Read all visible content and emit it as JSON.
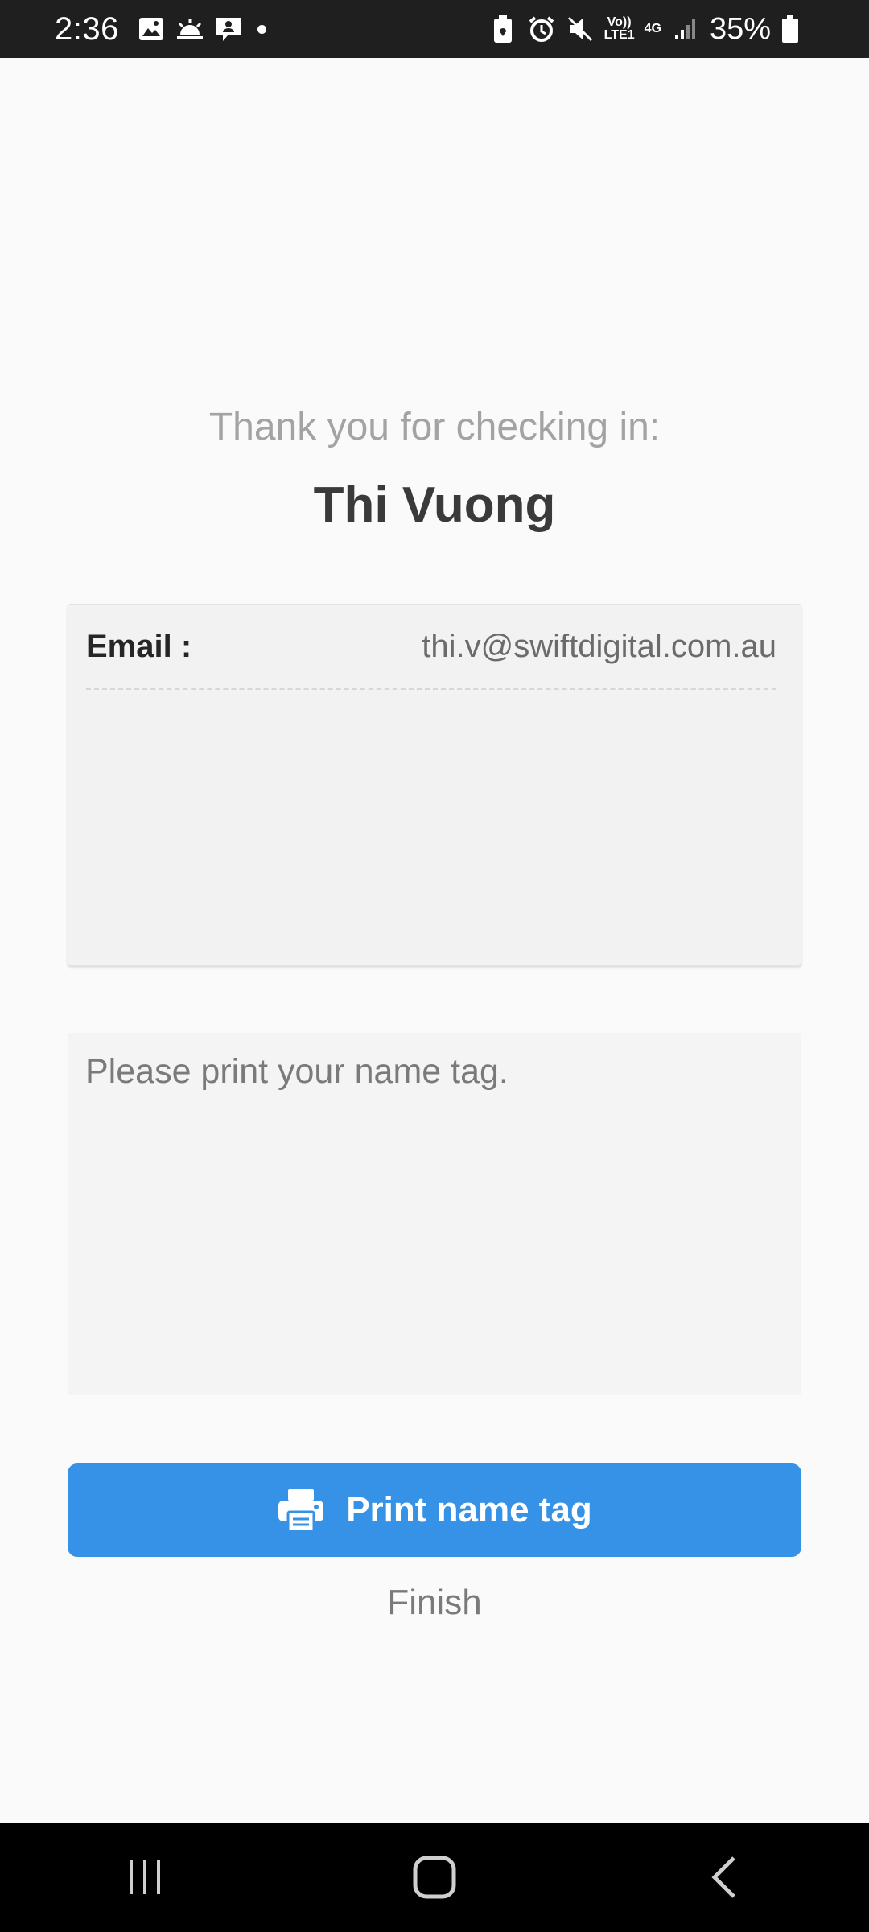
{
  "status_bar": {
    "time": "2:36",
    "battery_percent": "35%",
    "left_icons": [
      "gallery-icon",
      "weather-icon",
      "contact-message-icon",
      "notification-dot"
    ],
    "right_icons": [
      "battery-saver-icon",
      "alarm-icon",
      "mute-icon",
      "volte-icon",
      "network-4g-icon",
      "signal-icon",
      "battery-icon"
    ],
    "volte_label": "Vo))\nLTE1",
    "network_label": "4G"
  },
  "checkin": {
    "thanks_text": "Thank you for checking in:",
    "guest_name": "Thi Vuong"
  },
  "details": {
    "email_label": "Email :",
    "email_value": "thi.v@swiftdigital.com.au"
  },
  "message": {
    "text": "Please print your name tag."
  },
  "actions": {
    "print_label": "Print name tag",
    "print_icon": "printer-icon",
    "finish_label": "Finish"
  },
  "nav_bar": {
    "buttons": [
      "recent-apps-icon",
      "home-icon",
      "back-icon"
    ]
  },
  "colors": {
    "accent": "#3592e6",
    "background": "#fafafa",
    "status_bar": "#1f1f1f",
    "nav_bar": "#000000"
  }
}
